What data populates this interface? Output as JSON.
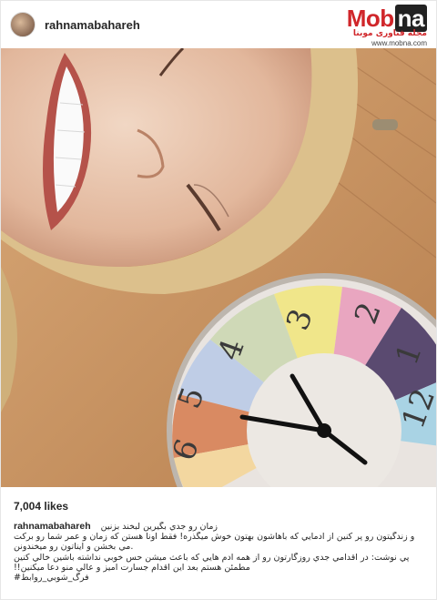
{
  "post": {
    "username": "rahnamabahareh",
    "likes": "7,004 likes",
    "caption": {
      "username": "rahnamabahareh",
      "lines": [
        "زمان رو جدي بگيرين لبخند بزنين",
        "و زندگيتون رو پر كنين از آدمايي كه باهاشون بهتون خوش ميگذره! فقط اونا هستن كه زمان و عمر شما رو بركت",
        "مي بخشن و آيناتون رو ميخندونن.",
        "پي نوشت: در اقدامي جدي روزگارتون رو از همه آدم هايي كه باعث ميشن حس خوبي نداشته باشين خالي كنين",
        "!!مطمئن هستم بعد اين اقدام جسارت اميز و عالي منو دعا ميكنين",
        "#فرگ_شوبي_روابط"
      ]
    }
  },
  "watermark": {
    "logo_main": "Mob",
    "logo_box": "na",
    "tagline": "مجله فناوری موبنا",
    "url": "www.mobna.com"
  },
  "photo": {
    "clock_numerals": [
      "3",
      "4",
      "5",
      "6",
      "2",
      "1",
      "12"
    ]
  }
}
